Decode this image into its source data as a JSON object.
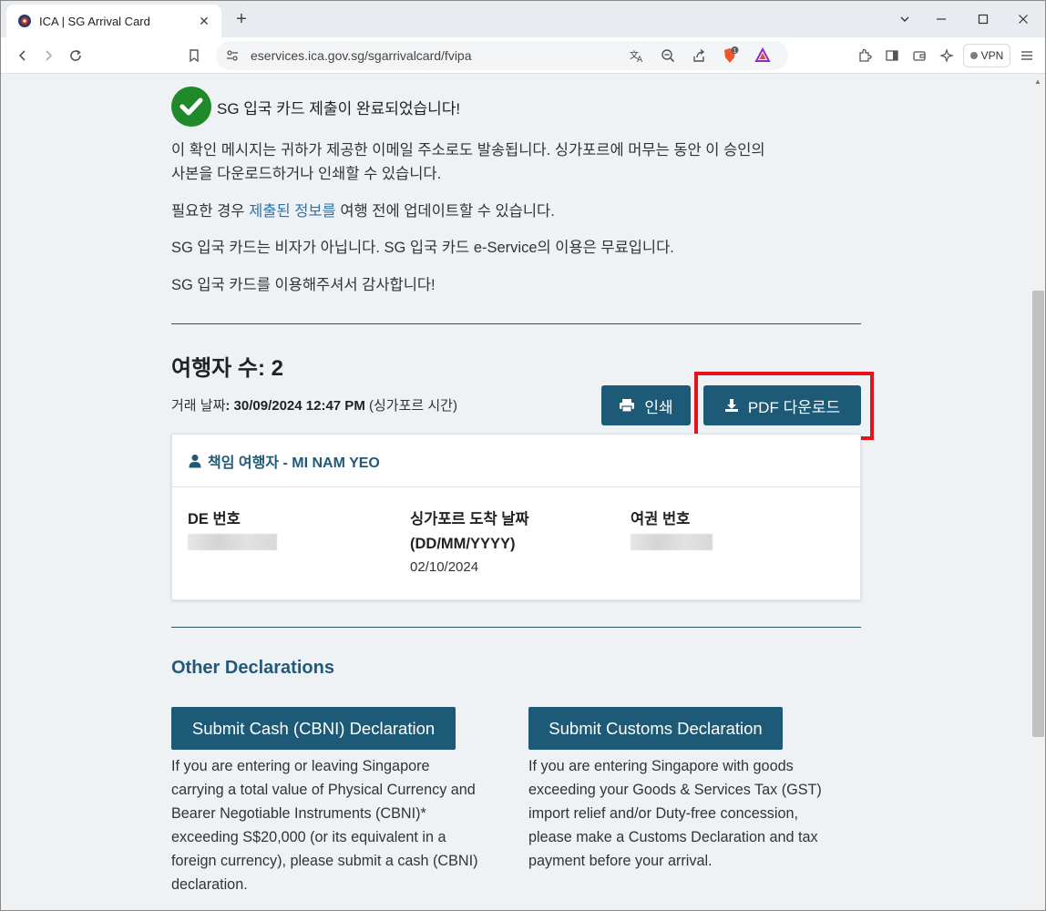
{
  "browser": {
    "tab_title": "ICA | SG Arrival Card",
    "url": "eservices.ica.gov.sg/sgarrivalcard/fvipa",
    "vpn_label": "VPN",
    "brave_badge": "1",
    "new_tab": "+",
    "tab_close": "✕"
  },
  "page": {
    "success_message": "SG 입국 카드 제출이 완료되었습니다!",
    "para1_line1": "이 확인 메시지는 귀하가 제공한 이메일 주소로도 발송됩니다. 싱가포르에 머무는 동안 이 승인의",
    "para1_line2": "사본을 다운로드하거나 인쇄할 수 있습니다.",
    "para2_prefix": "필요한 경우 ",
    "para2_link": "제출된 정보를",
    "para2_suffix": " 여행 전에 업데이트할 수 있습니다.",
    "para3": "SG 입국 카드는 비자가 아닙니다. SG 입국 카드 e-Service의 이용은 무료입니다.",
    "para4": "SG 입국 카드를 이용해주셔서 감사합니다!",
    "travellers_title": "여행자 수: 2",
    "tx_date_label": "거래 날짜",
    "tx_date_value": ": 30/09/2024 12:47 PM",
    "tx_date_suffix": " (싱가포르 시간)",
    "print_label": "인쇄",
    "pdf_label": "PDF 다운로드",
    "lead_traveller": "책임 여행자 - MI NAM YEO",
    "de_label": "DE 번호",
    "arrival_label_1": "싱가포르 도착 날짜",
    "arrival_label_2": "(DD/MM/YYYY)",
    "arrival_value": "02/10/2024",
    "passport_label": "여권 번호",
    "other_title": "Other Declarations",
    "cash_button": "Submit Cash (CBNI) Declaration",
    "cash_desc": [
      "If you are entering or leaving Singapore",
      "carrying a total value of Physical Currency and",
      "Bearer Negotiable Instruments (CBNI)*",
      "exceeding S$20,000 (or its equivalent in a",
      "foreign currency), please submit a cash (CBNI)",
      "declaration."
    ],
    "customs_button": "Submit Customs Declaration",
    "customs_desc": [
      "If you are entering Singapore with goods",
      "exceeding your Goods & Services Tax (GST)",
      "import relief and/or Duty-free concession,",
      "please make a Customs Declaration and tax",
      "payment before your arrival."
    ]
  },
  "colors": {
    "primary_button": "#1d5a78",
    "success_green": "#1f8a2a",
    "highlight_red": "#e8121a",
    "link": "#2e73a8"
  }
}
